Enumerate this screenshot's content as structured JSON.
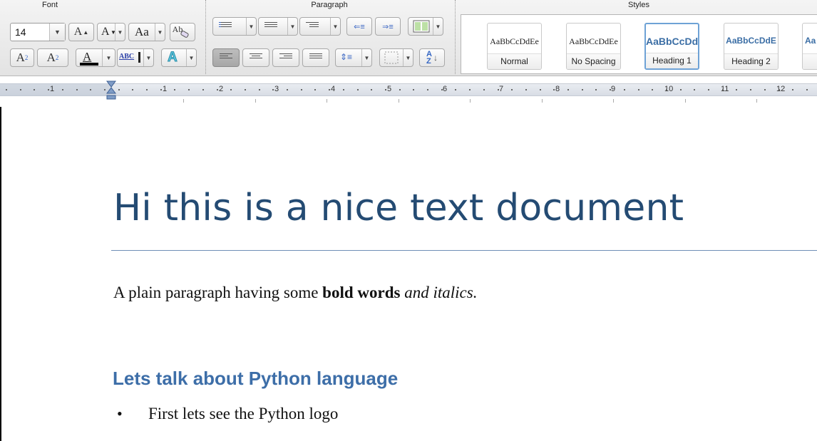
{
  "ribbon": {
    "groups": {
      "font": "Font",
      "paragraph": "Paragraph",
      "styles": "Styles"
    },
    "font": {
      "size": "14",
      "grow_label": "A",
      "shrink_label": "A",
      "change_case_label": "Aa",
      "clear_format_label": "Ab",
      "superscript_label": "A",
      "superscript_mark": "2",
      "subscript_label": "A",
      "subscript_mark": "2",
      "font_color_label": "A",
      "font_color": "#000000",
      "highlight_label": "ABC",
      "text_effects_label": "A",
      "text_effects_color": "#5ec8e0"
    },
    "paragraph": {
      "sort_label": "A",
      "sort_label2": "Z"
    },
    "styles": [
      {
        "preview": "AaBbCcDdEe",
        "name": "Normal",
        "selected": false
      },
      {
        "preview": "AaBbCcDdEe",
        "name": "No Spacing",
        "selected": false
      },
      {
        "preview": "AaBbCcDdI",
        "name": "Heading 1",
        "selected": true
      },
      {
        "preview": "AaBbCcDdE",
        "name": "Heading 2",
        "selected": false
      },
      {
        "preview": "Aa",
        "name": "",
        "selected": false
      }
    ]
  },
  "ruler": {
    "numbers": [
      "1",
      "1",
      "2",
      "3",
      "4",
      "5",
      "6",
      "7",
      "8",
      "9",
      "10",
      "11",
      "12"
    ]
  },
  "document": {
    "title": "Hi this is a nice text document",
    "paragraph": {
      "plain": "A plain paragraph having some ",
      "bold": "bold words",
      "space": " ",
      "italic": "and italics."
    },
    "heading": "Lets talk about Python language",
    "bullet_symbol": "•",
    "bullet_text": "First lets see the Python logo"
  },
  "colors": {
    "title": "#244b73",
    "heading": "#3d6ea8",
    "selection_border": "#6ea2d6"
  }
}
